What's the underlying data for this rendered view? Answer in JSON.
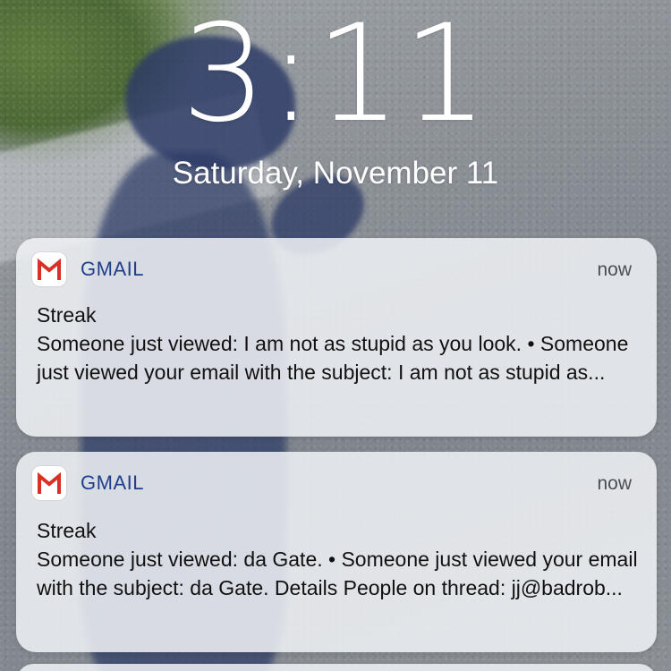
{
  "lockscreen": {
    "time": "3:11",
    "date": "Saturday, November 11"
  },
  "notifications": [
    {
      "app": "GMAIL",
      "icon": "gmail-icon",
      "time": "now",
      "title": "Streak",
      "body": "Someone just viewed: I am not as stupid as you look.  •  Someone just viewed your email with the subject: I am not as stupid as..."
    },
    {
      "app": "GMAIL",
      "icon": "gmail-icon",
      "time": "now",
      "title": "Streak",
      "body": "Someone just viewed: da Gate.  •  Someone just viewed your email with the subject: da Gate. Details People on thread: jj@badrob..."
    }
  ],
  "colors": {
    "gmail_red": "#d93025",
    "app_name_blue": "#1f3f8c"
  }
}
